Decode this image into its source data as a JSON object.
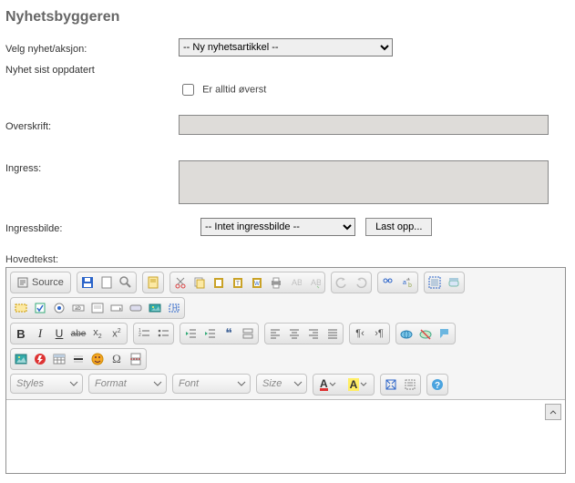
{
  "page_title": "Nyhetsbyggeren",
  "labels": {
    "velg": "Velg nyhet/aksjon:",
    "oppdatert": "Nyhet sist oppdatert",
    "alltid_overst": "Er alltid øverst",
    "overskrift": "Overskrift:",
    "ingress": "Ingress:",
    "ingressbilde": "Ingressbilde:",
    "hovedtekst": "Hovedtekst:"
  },
  "selects": {
    "nyhet_value": "-- Ny nyhetsartikkel --",
    "ingressbilde_value": "-- Intet ingressbilde --"
  },
  "buttons": {
    "last_opp": "Last opp..."
  },
  "editor": {
    "source_label": "Source",
    "combos": {
      "styles": "Styles",
      "format": "Format",
      "font": "Font",
      "size": "Size"
    }
  }
}
